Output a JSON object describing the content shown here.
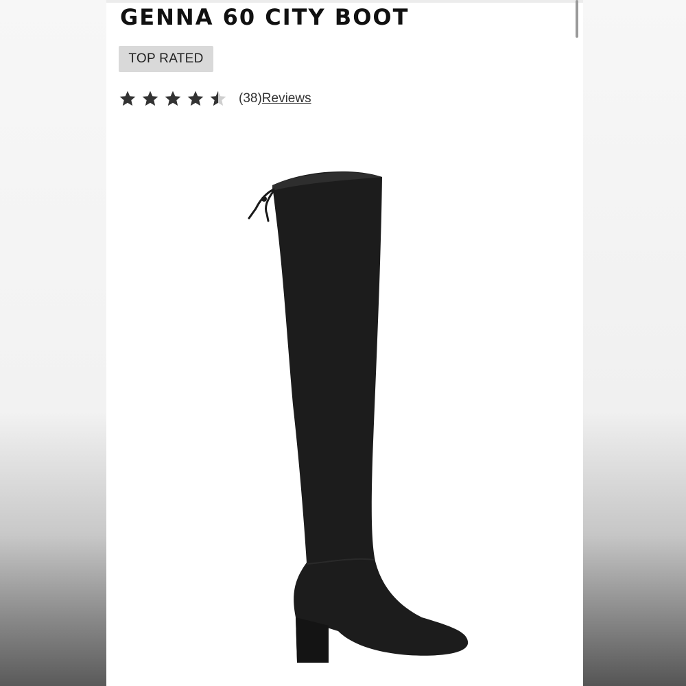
{
  "product": {
    "title": "GENNA 60 CITY BOOT",
    "badge": "TOP RATED",
    "rating": {
      "value": 4.5,
      "max": 5,
      "count_text": "(38)",
      "reviews_link": "Reviews"
    },
    "image": {
      "icon": "black-over-the-knee-boot"
    }
  },
  "colors": {
    "star": "#333333",
    "badge_bg": "#d9d9d9",
    "boot": "#1c1c1c"
  }
}
